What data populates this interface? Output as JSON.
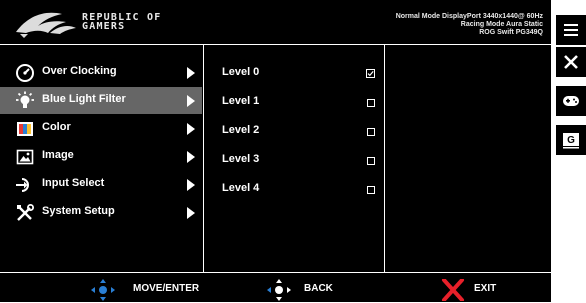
{
  "header": {
    "brand_line1": "REPUBLIC OF",
    "brand_line2": "GAMERS",
    "status_line1": "Normal Mode DisplayPort 3440x1440@ 60Hz",
    "status_line2": "Racing Mode Aura Static",
    "status_line3": "ROG Swift PG349Q"
  },
  "menu": {
    "selected_index": 1,
    "items": [
      {
        "label": "Over Clocking",
        "icon": "speedometer-icon"
      },
      {
        "label": "Blue Light Filter",
        "icon": "bulb-icon"
      },
      {
        "label": "Color",
        "icon": "color-icon"
      },
      {
        "label": "Image",
        "icon": "image-icon"
      },
      {
        "label": "Input Select",
        "icon": "input-icon"
      },
      {
        "label": "System Setup",
        "icon": "tools-icon"
      }
    ]
  },
  "submenu": {
    "checked_index": 0,
    "items": [
      {
        "label": "Level 0"
      },
      {
        "label": "Level 1"
      },
      {
        "label": "Level 2"
      },
      {
        "label": "Level 3"
      },
      {
        "label": "Level 4"
      }
    ]
  },
  "footer": {
    "move_label": "MOVE/ENTER",
    "back_label": "BACK",
    "exit_label": "EXIT"
  },
  "side_buttons": [
    {
      "icon": "menu-icon"
    },
    {
      "icon": "close-icon"
    },
    {
      "icon": "gamepad-icon"
    },
    {
      "icon": "gameplus-icon",
      "text": "G"
    }
  ],
  "colors": {
    "accent_blue": "#2a7fd4",
    "exit_red": "#e8202a",
    "highlight": "#666666"
  }
}
